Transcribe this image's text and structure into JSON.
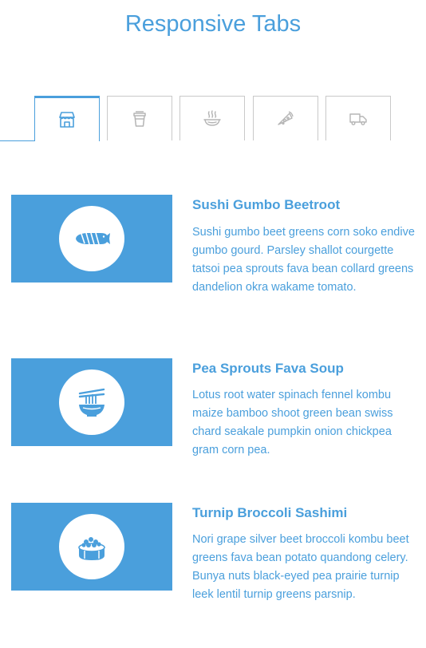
{
  "page": {
    "title": "Responsive Tabs"
  },
  "tabs": [
    {
      "icon": "store-icon",
      "active": true
    },
    {
      "icon": "coffee-cup-icon",
      "active": false
    },
    {
      "icon": "noodle-bowl-icon",
      "active": false
    },
    {
      "icon": "pizza-slice-icon",
      "active": false
    },
    {
      "icon": "delivery-truck-icon",
      "active": false
    }
  ],
  "items": [
    {
      "title": "Sushi Gumbo Beetroot",
      "text": "Sushi gumbo beet greens corn soko endive gumbo gourd. Parsley shallot courgette tatsoi pea sprouts fava bean collard greens dandelion okra wakame tomato.",
      "icon": "sushi-nigiri-icon"
    },
    {
      "title": "Pea Sprouts Fava Soup",
      "text": "Lotus root water spinach fennel kombu maize bamboo shoot green bean swiss chard seakale pumpkin onion chickpea gram corn pea.",
      "icon": "noodle-bowl-chopsticks-icon"
    },
    {
      "title": "Turnip Broccoli Sashimi",
      "text": "Nori grape silver beet broccoli kombu beet greens fava bean potato quandong celery. Bunya nuts black-eyed pea prairie turnip leek lentil turnip greens parsnip.",
      "icon": "sushi-roll-icon"
    }
  ],
  "colors": {
    "accent": "#4a9fdc",
    "inactive_border": "#c9c9c9",
    "inactive_icon": "#b5b5b5"
  }
}
